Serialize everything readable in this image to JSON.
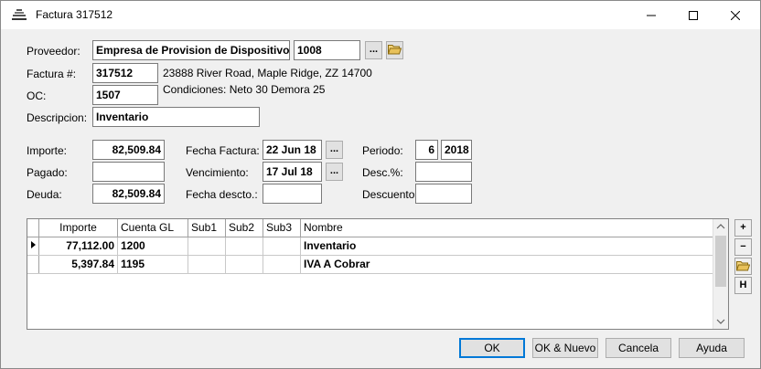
{
  "window": {
    "title": "Factura 317512",
    "minimize_glyph": "—",
    "maximize_glyph": "☐",
    "close_glyph": "✕"
  },
  "labels": {
    "proveedor": "Proveedor:",
    "factura": "Factura #:",
    "oc": "OC:",
    "descripcion": "Descripcion:",
    "importe": "Importe:",
    "pagado": "Pagado:",
    "deuda": "Deuda:",
    "fecha_factura": "Fecha Factura:",
    "vencimiento": "Vencimiento:",
    "fecha_descto": "Fecha descto.:",
    "periodo": "Periodo:",
    "desc_pct": "Desc.%:",
    "descuento": "Descuento:"
  },
  "fields": {
    "proveedor_nombre": "Empresa de Provision de Dispositivos",
    "proveedor_codigo": "1008",
    "factura_num": "317512",
    "oc": "1507",
    "descripcion": "Inventario",
    "importe": "82,509.84",
    "pagado": "",
    "deuda": "82,509.84",
    "fecha_factura": "22 Jun 18",
    "vencimiento": "17 Jul 18",
    "fecha_descto": "",
    "periodo_mes": "6",
    "periodo_anio": "2018",
    "desc_pct": "",
    "descuento": ""
  },
  "info": {
    "address": "23888 River Road, Maple Ridge, ZZ  14700",
    "terms": "Condiciones: Neto 30   Demora 25"
  },
  "buttons": {
    "ellipsis": "...",
    "ok": "OK",
    "ok_nuevo": "OK & Nuevo",
    "cancela": "Cancela",
    "ayuda": "Ayuda",
    "add": "+",
    "remove": "−",
    "hold": "H"
  },
  "grid": {
    "columns": [
      "Importe",
      "Cuenta GL",
      "Sub1",
      "Sub2",
      "Sub3",
      "Nombre"
    ],
    "rows": [
      {
        "importe": "77,112.00",
        "cuenta": "1200",
        "sub1": "",
        "sub2": "",
        "sub3": "",
        "nombre": "Inventario"
      },
      {
        "importe": "5,397.84",
        "cuenta": "1195",
        "sub1": "",
        "sub2": "",
        "sub3": "",
        "nombre": "IVA A Cobrar"
      }
    ]
  },
  "colors": {
    "folder": "#e8c15a",
    "default_button_border": "#0078d7"
  }
}
